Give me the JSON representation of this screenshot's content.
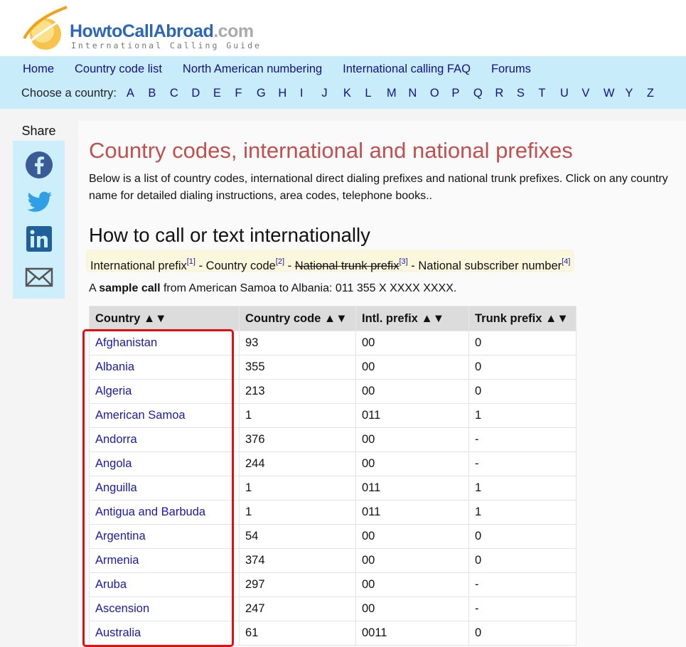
{
  "logo": {
    "main_a": "HowtoCallAbroad",
    "main_b": ".com",
    "subtitle": "International Calling Guide"
  },
  "nav": {
    "links": [
      "Home",
      "Country code list",
      "North American numbering",
      "International calling FAQ",
      "Forums"
    ],
    "choose_label": "Choose a country:",
    "letters": [
      "A",
      "B",
      "C",
      "D",
      "E",
      "F",
      "G",
      "H",
      "I",
      "J",
      "K",
      "L",
      "M",
      "N",
      "O",
      "P",
      "Q",
      "R",
      "S",
      "T",
      "U",
      "V",
      "W",
      "Y",
      "Z"
    ]
  },
  "share": {
    "title": "Share",
    "icons": [
      "facebook-icon",
      "twitter-icon",
      "linkedin-icon",
      "email-icon"
    ]
  },
  "page": {
    "title": "Country codes, international and national prefixes",
    "intro": "Below is a list of country codes, international direct dialing prefixes and national trunk prefixes. Click on any country name for detailed dialing instructions, area codes, telephone books..",
    "subtitle": "How to call or text internationally",
    "legend": {
      "intl_prefix": "International prefix",
      "ref1": "[1]",
      "sep1": " - ",
      "country_code": "Country code",
      "ref2": "[2]",
      "sep2": " - ",
      "trunk_prefix": "National trunk prefix",
      "ref3": "[3]",
      "sep3": " - ",
      "subscriber": "National subscriber number",
      "ref4": "[4]"
    },
    "sample": {
      "prefix": "A ",
      "bold": "sample call",
      "rest": " from American Samoa to Albania: 011 355 X XXXX XXXX."
    }
  },
  "table": {
    "headers": [
      "Country ▲▼",
      "Country code ▲▼",
      "Intl. prefix ▲▼",
      "Trunk prefix ▲▼"
    ],
    "rows": [
      [
        "Afghanistan",
        "93",
        "00",
        "0"
      ],
      [
        "Albania",
        "355",
        "00",
        "0"
      ],
      [
        "Algeria",
        "213",
        "00",
        "0"
      ],
      [
        "American Samoa",
        "1",
        "011",
        "1"
      ],
      [
        "Andorra",
        "376",
        "00",
        "-"
      ],
      [
        "Angola",
        "244",
        "00",
        "-"
      ],
      [
        "Anguilla",
        "1",
        "011",
        "1"
      ],
      [
        "Antigua and Barbuda",
        "1",
        "011",
        "1"
      ],
      [
        "Argentina",
        "54",
        "00",
        "0"
      ],
      [
        "Armenia",
        "374",
        "00",
        "0"
      ],
      [
        "Aruba",
        "297",
        "00",
        "-"
      ],
      [
        "Ascension",
        "247",
        "00",
        "-"
      ],
      [
        "Australia",
        "61",
        "0011",
        "0"
      ]
    ]
  },
  "colors": {
    "nav_bg": "#c9ecfb",
    "title_red": "#c0504d",
    "link_blue": "#1a1aa8",
    "highlight_red": "#e01010"
  }
}
